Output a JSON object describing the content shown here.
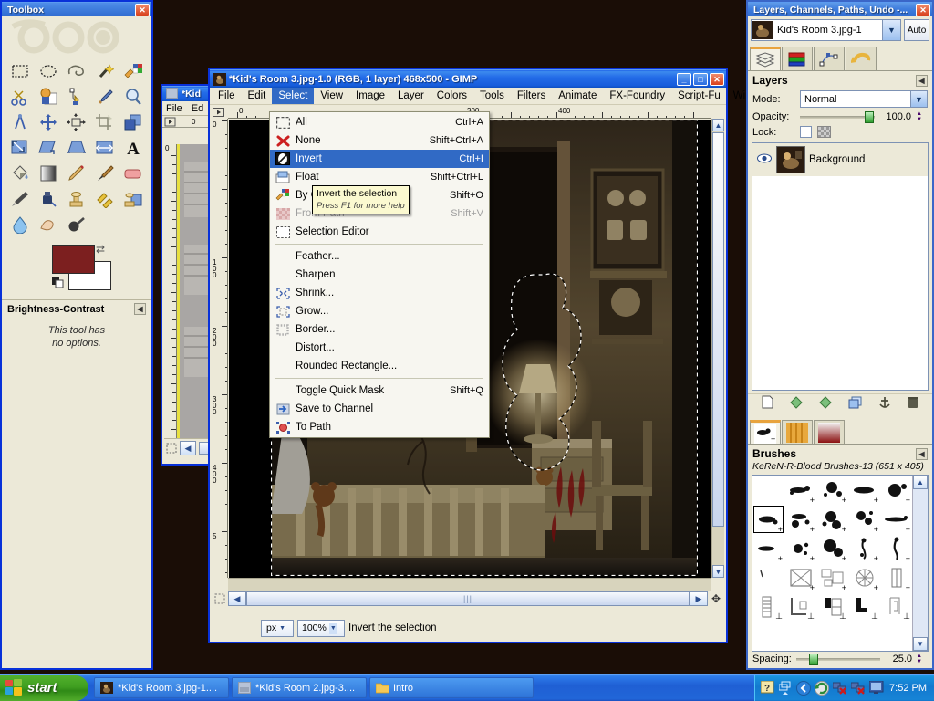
{
  "toolbox": {
    "title": "Toolbox",
    "close_label": "✕",
    "tools": [
      {
        "name": "rect-select-tool",
        "glyph": "rect-select"
      },
      {
        "name": "ellipse-select-tool",
        "glyph": "ellipse-select"
      },
      {
        "name": "free-select-tool",
        "glyph": "lasso"
      },
      {
        "name": "fuzzy-select-tool",
        "glyph": "wand"
      },
      {
        "name": "select-by-color-tool",
        "glyph": "by-color"
      },
      {
        "name": "scissors-select-tool",
        "glyph": "scissors"
      },
      {
        "name": "foreground-select-tool",
        "glyph": "fg-select"
      },
      {
        "name": "paths-tool",
        "glyph": "path"
      },
      {
        "name": "color-picker-tool",
        "glyph": "eyedropper"
      },
      {
        "name": "zoom-tool",
        "glyph": "magnifier"
      },
      {
        "name": "measure-tool",
        "glyph": "compass"
      },
      {
        "name": "move-tool",
        "glyph": "move"
      },
      {
        "name": "alignment-tool",
        "glyph": "align"
      },
      {
        "name": "crop-tool",
        "glyph": "crop"
      },
      {
        "name": "rotate-tool",
        "glyph": "rotate"
      },
      {
        "name": "scale-tool",
        "glyph": "scale"
      },
      {
        "name": "shear-tool",
        "glyph": "shear"
      },
      {
        "name": "perspective-tool",
        "glyph": "perspective"
      },
      {
        "name": "flip-tool",
        "glyph": "flip"
      },
      {
        "name": "text-tool",
        "glyph": "text"
      },
      {
        "name": "bucket-fill-tool",
        "glyph": "bucket"
      },
      {
        "name": "blend-tool",
        "glyph": "gradient"
      },
      {
        "name": "pencil-tool",
        "glyph": "pencil"
      },
      {
        "name": "paintbrush-tool",
        "glyph": "brush"
      },
      {
        "name": "eraser-tool",
        "glyph": "eraser"
      },
      {
        "name": "airbrush-tool",
        "glyph": "airbrush"
      },
      {
        "name": "ink-tool",
        "glyph": "ink"
      },
      {
        "name": "clone-tool",
        "glyph": "clone"
      },
      {
        "name": "heal-tool",
        "glyph": "heal"
      },
      {
        "name": "perspective-clone-tool",
        "glyph": "persp-clone"
      },
      {
        "name": "blur-sharpen-tool",
        "glyph": "blur"
      },
      {
        "name": "smudge-tool",
        "glyph": "smudge"
      },
      {
        "name": "dodge-burn-tool",
        "glyph": "dodge"
      }
    ],
    "foreground_color": "#7c1f1f",
    "background_color": "#ffffff",
    "tool_options_title": "Brightness-Contrast",
    "tool_options_text_line1": "This tool has",
    "tool_options_text_line2": "no options."
  },
  "image_window_back": {
    "title": "*Kid",
    "menus": [
      "File",
      "Ed"
    ],
    "ruler_origin": "0",
    "ruler_v_origin": "0"
  },
  "image_window": {
    "title": "*Kid's Room 3.jpg-1.0 (RGB, 1 layer) 468x500 - GIMP",
    "minimize_label": "_",
    "maximize_label": "□",
    "close_label": "✕",
    "menus": [
      {
        "label": "File",
        "active": false
      },
      {
        "label": "Edit",
        "active": false
      },
      {
        "label": "Select",
        "active": true
      },
      {
        "label": "View",
        "active": false
      },
      {
        "label": "Image",
        "active": false
      },
      {
        "label": "Layer",
        "active": false
      },
      {
        "label": "Colors",
        "active": false
      },
      {
        "label": "Tools",
        "active": false
      },
      {
        "label": "Filters",
        "active": false
      },
      {
        "label": "Animate",
        "active": false
      },
      {
        "label": "FX-Foundry",
        "active": false
      },
      {
        "label": "Script-Fu",
        "active": false
      },
      {
        "label": "Wind",
        "active": false
      }
    ],
    "ruler_h_labels": [
      "0",
      "300",
      "400"
    ],
    "ruler_v_labels": [
      "0",
      "100",
      "200",
      "300",
      "400",
      "5"
    ],
    "unit_value": "px",
    "zoom_value": "100%",
    "status_text": "Invert the selection"
  },
  "select_menu": {
    "items": [
      {
        "label": "All",
        "accel": "Ctrl+A",
        "icon": "select-all-icon",
        "state": "normal"
      },
      {
        "label": "None",
        "accel": "Shift+Ctrl+A",
        "icon": "select-none-icon",
        "state": "normal"
      },
      {
        "label": "Invert",
        "accel": "Ctrl+I",
        "icon": "select-invert-icon",
        "state": "highlighted"
      },
      {
        "label": "Float",
        "accel": "Shift+Ctrl+L",
        "icon": "select-float-icon",
        "state": "normal"
      },
      {
        "label": "By Color",
        "accel": "Shift+O",
        "icon": "select-by-color-icon",
        "state": "normal"
      },
      {
        "label": "From Path",
        "accel": "Shift+V",
        "icon": "select-from-path-icon",
        "state": "disabled"
      },
      {
        "label": "Selection Editor",
        "accel": "",
        "icon": "selection-editor-icon",
        "state": "normal"
      },
      {
        "separator": true
      },
      {
        "label": "Feather...",
        "accel": "",
        "icon": "",
        "state": "normal"
      },
      {
        "label": "Sharpen",
        "accel": "",
        "icon": "",
        "state": "normal"
      },
      {
        "label": "Shrink...",
        "accel": "",
        "icon": "shrink-icon",
        "state": "normal"
      },
      {
        "label": "Grow...",
        "accel": "",
        "icon": "grow-icon",
        "state": "normal"
      },
      {
        "label": "Border...",
        "accel": "",
        "icon": "border-icon",
        "state": "normal"
      },
      {
        "label": "Distort...",
        "accel": "",
        "icon": "",
        "state": "normal"
      },
      {
        "label": "Rounded Rectangle...",
        "accel": "",
        "icon": "",
        "state": "normal"
      },
      {
        "separator": true
      },
      {
        "label": "Toggle Quick Mask",
        "accel": "Shift+Q",
        "icon": "",
        "state": "normal"
      },
      {
        "label": "Save to Channel",
        "accel": "",
        "icon": "save-to-channel-icon",
        "state": "normal"
      },
      {
        "label": "To Path",
        "accel": "",
        "icon": "to-path-icon",
        "state": "normal"
      }
    ]
  },
  "tooltip": {
    "line1": "Invert the selection",
    "line2": "Press F1 for more help"
  },
  "dock": {
    "title": "Layers, Channels, Paths, Undo -...",
    "close_label": "✕",
    "image_name": "Kid's Room 3.jpg-1",
    "auto_label": "Auto",
    "tabs": [
      {
        "name": "layers-tab",
        "selected": true
      },
      {
        "name": "channels-tab",
        "selected": false
      },
      {
        "name": "paths-tab",
        "selected": false
      },
      {
        "name": "undo-history-tab",
        "selected": false
      }
    ],
    "layers": {
      "title": "Layers",
      "mode_label": "Mode:",
      "mode_value": "Normal",
      "opacity_label": "Opacity:",
      "opacity_value": "100.0",
      "lock_label": "Lock:",
      "items": [
        {
          "name": "Background",
          "visible": true
        }
      ],
      "buttons": [
        "new-layer-button",
        "raise-layer-button",
        "lower-layer-button",
        "duplicate-layer-button",
        "anchor-layer-button",
        "delete-layer-button"
      ]
    },
    "brush_tabs": [
      {
        "name": "brushes-tab",
        "selected": true
      },
      {
        "name": "patterns-tab",
        "selected": false
      },
      {
        "name": "gradients-tab",
        "selected": false
      }
    ],
    "brushes": {
      "title": "Brushes",
      "current_brush": "KeReN-R-Blood Brushes-13 (651 x 405)",
      "spacing_label": "Spacing:",
      "spacing_value": "25.0"
    }
  },
  "taskbar": {
    "start_label": "start",
    "items": [
      {
        "label": "*Kid's Room 3.jpg-1....",
        "icon": "gimp-image-icon"
      },
      {
        "label": "*Kid's Room 2.jpg-3....",
        "icon": "gimp-image-icon"
      },
      {
        "label": "Intro",
        "icon": "folder-icon"
      }
    ],
    "tray": {
      "clock": "7:52 PM",
      "icons": [
        "help-icon",
        "window-stack-icon",
        "back-arrow-icon",
        "updates-icon",
        "network-disconnected-icon",
        "network-disconnected-2-icon",
        "monitor-icon"
      ]
    }
  },
  "colors": {
    "xp_blue": "#0831d9",
    "xp_title_blue": "#175ddc",
    "menu_highlight": "#316ac5",
    "panel_bg": "#ece9d8",
    "tooltip_bg": "#fbf9d0",
    "fg_swatch": "#7c1f1f",
    "desktop": "#1a0d06"
  }
}
